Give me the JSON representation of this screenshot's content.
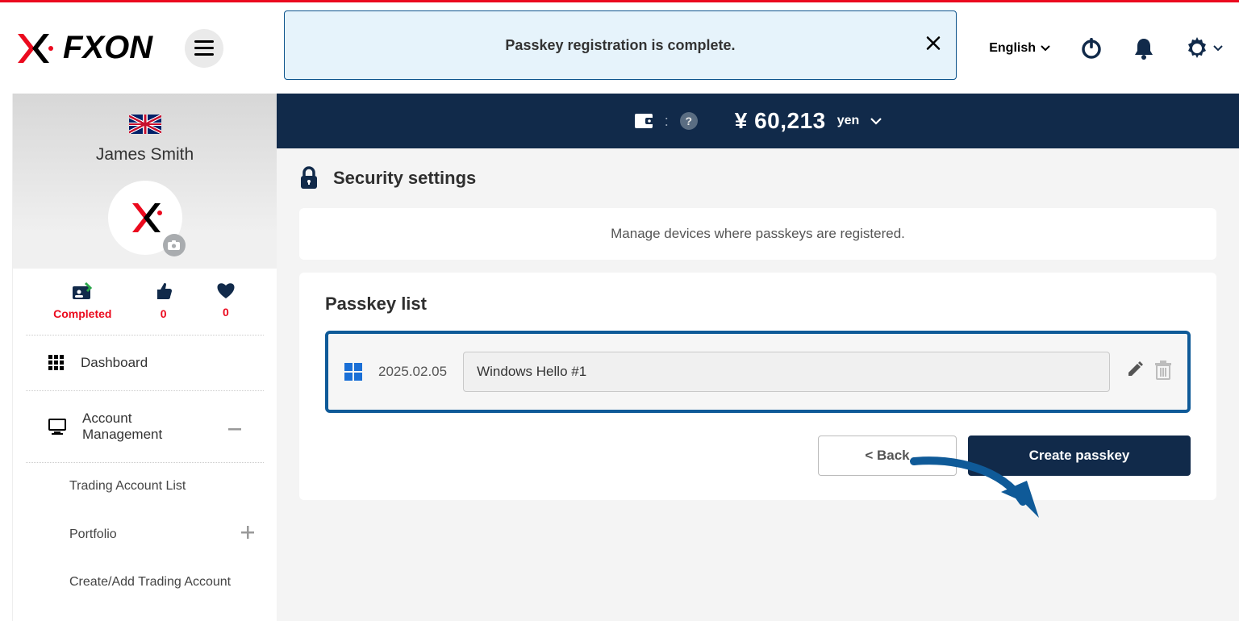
{
  "toast": {
    "message": "Passkey registration is complete."
  },
  "header": {
    "language": "English"
  },
  "balance": {
    "symbol": "¥",
    "amount": "60,213",
    "currency": "yen"
  },
  "user": {
    "name": "James Smith",
    "stats": {
      "status_label": "Completed",
      "likes": "0",
      "favs": "0"
    }
  },
  "nav": {
    "dashboard": "Dashboard",
    "account_mgmt": "Account Management",
    "subs": {
      "trading_list": "Trading Account List",
      "portfolio": "Portfolio",
      "create_add": "Create/Add Trading Account"
    }
  },
  "page": {
    "title": "Security settings",
    "info": "Manage devices where passkeys are registered.",
    "list_title": "Passkey list",
    "passkeys": [
      {
        "date": "2025.02.05",
        "name": "Windows Hello #1"
      }
    ],
    "buttons": {
      "back": "< Back",
      "create": "Create passkey"
    }
  }
}
